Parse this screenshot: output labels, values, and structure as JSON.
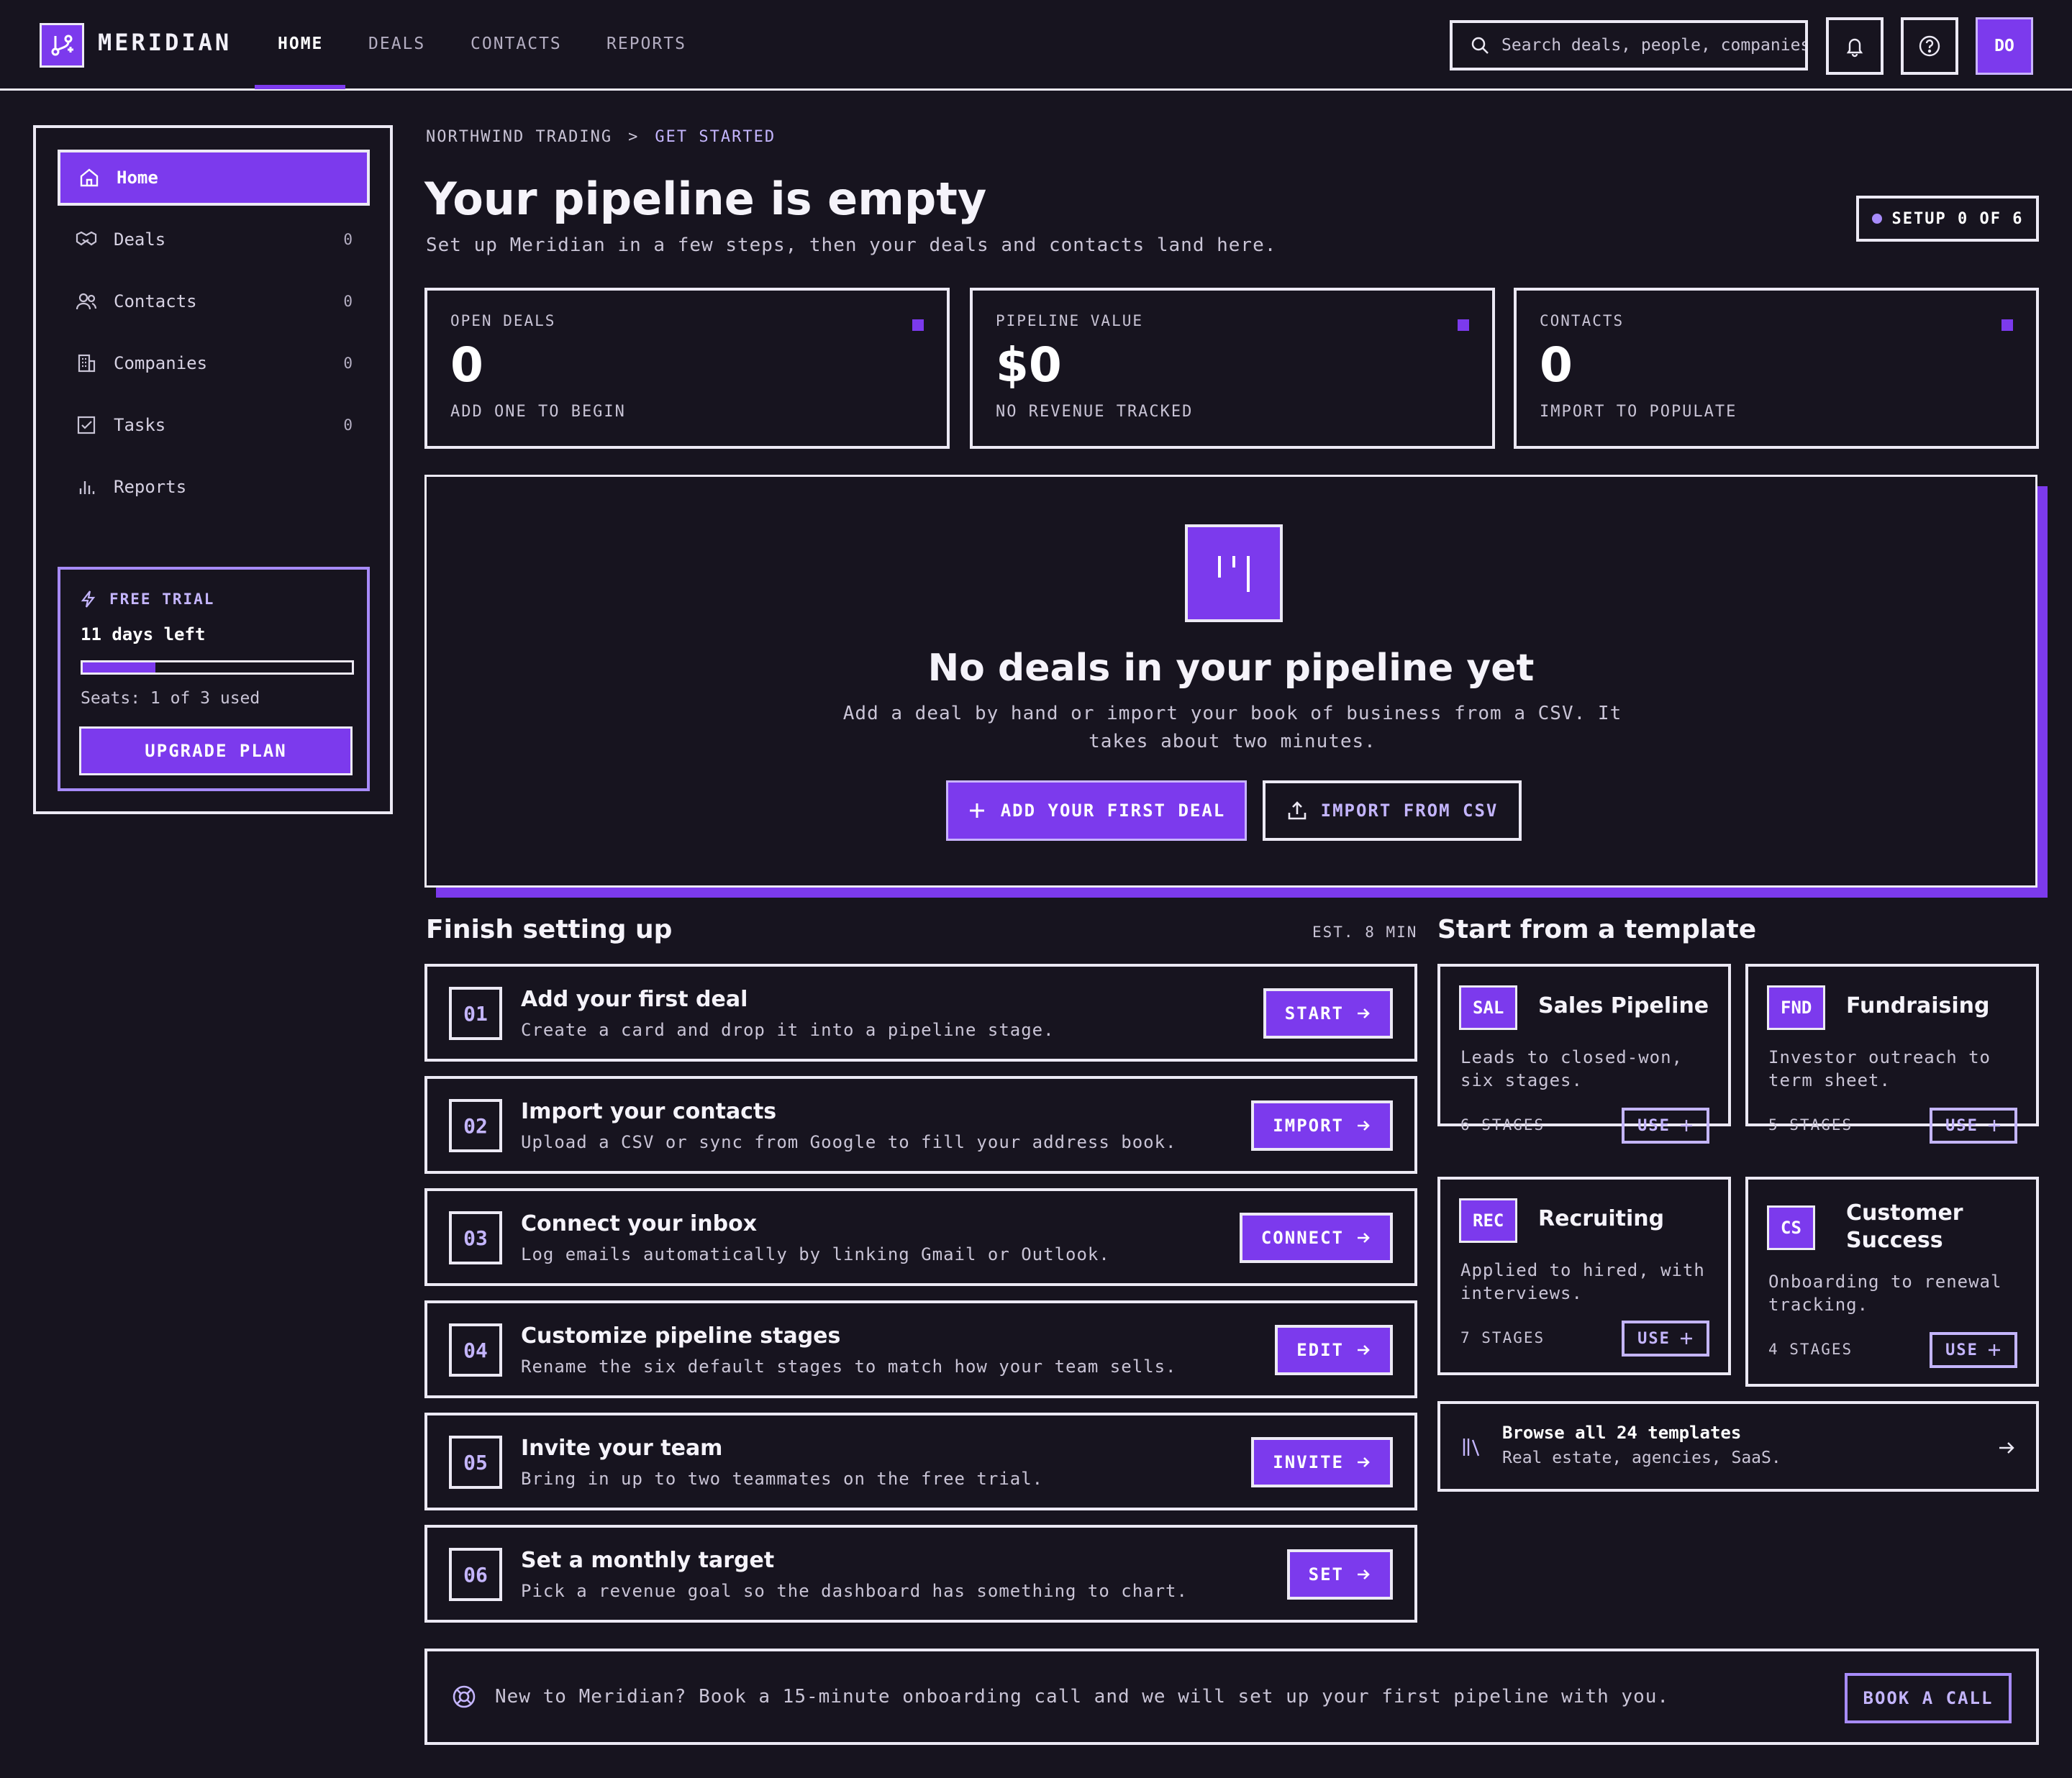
{
  "app": {
    "brand": "MERIDIAN"
  },
  "nav": {
    "tabs": [
      {
        "label": "HOME",
        "active": true
      },
      {
        "label": "DEALS"
      },
      {
        "label": "CONTACTS"
      },
      {
        "label": "REPORTS"
      }
    ]
  },
  "search": {
    "placeholder": "Search deals, people, companies"
  },
  "user": {
    "initials": "DO"
  },
  "sidebar": {
    "items": [
      {
        "label": "Home",
        "icon": "home-icon",
        "active": true
      },
      {
        "label": "Deals",
        "icon": "handshake-icon",
        "count": "0"
      },
      {
        "label": "Contacts",
        "icon": "users-icon",
        "count": "0"
      },
      {
        "label": "Companies",
        "icon": "building-icon",
        "count": "0"
      },
      {
        "label": "Tasks",
        "icon": "checkbox-icon",
        "count": "0"
      },
      {
        "label": "Reports",
        "icon": "bar-chart-icon"
      }
    ],
    "trial": {
      "label": "FREE TRIAL",
      "days": "11 days left",
      "progress_fraction": 0.27,
      "seats": "Seats: 1 of 3 used",
      "upgrade_label": "UPGRADE PLAN"
    }
  },
  "breadcrumb": {
    "parent": "NORTHWIND TRADING",
    "separator": ">",
    "current": "GET STARTED"
  },
  "page": {
    "title": "Your pipeline is empty",
    "subtitle": "Set up Meridian in a few steps, then your deals and contacts land here.",
    "setup_badge": "SETUP 0 OF 6"
  },
  "stats": [
    {
      "label": "OPEN DEALS",
      "value": "0",
      "hint": "ADD ONE TO BEGIN"
    },
    {
      "label": "PIPELINE VALUE",
      "value": "$0",
      "hint": "NO REVENUE TRACKED"
    },
    {
      "label": "CONTACTS",
      "value": "0",
      "hint": "IMPORT TO POPULATE"
    }
  ],
  "empty_state": {
    "title": "No deals in your pipeline yet",
    "description": "Add a deal by hand or import your book of business from a CSV. It takes about two minutes.",
    "primary_label": "ADD YOUR FIRST DEAL",
    "secondary_label": "IMPORT FROM CSV"
  },
  "setup": {
    "title": "Finish setting up",
    "estimate": "EST. 8 MIN",
    "steps": [
      {
        "num": "01",
        "title": "Add your first deal",
        "desc": "Create a card and drop it into a pipeline stage.",
        "action": "START"
      },
      {
        "num": "02",
        "title": "Import your contacts",
        "desc": "Upload a CSV or sync from Google to fill your address book.",
        "action": "IMPORT"
      },
      {
        "num": "03",
        "title": "Connect your inbox",
        "desc": "Log emails automatically by linking Gmail or Outlook.",
        "action": "CONNECT"
      },
      {
        "num": "04",
        "title": "Customize pipeline stages",
        "desc": "Rename the six default stages to match how your team sells.",
        "action": "EDIT"
      },
      {
        "num": "05",
        "title": "Invite your team",
        "desc": "Bring in up to two teammates on the free trial.",
        "action": "INVITE"
      },
      {
        "num": "06",
        "title": "Set a monthly target",
        "desc": "Pick a revenue goal so the dashboard has something to chart.",
        "action": "SET"
      }
    ]
  },
  "templates": {
    "title": "Start from a template",
    "items": [
      {
        "code": "SAL",
        "name": "Sales Pipeline",
        "desc": "Leads to closed-won, six stages.",
        "stages": "6 STAGES",
        "action": "USE"
      },
      {
        "code": "FND",
        "name": "Fundraising",
        "desc": "Investor outreach to term sheet.",
        "stages": "5 STAGES",
        "action": "USE"
      },
      {
        "code": "REC",
        "name": "Recruiting",
        "desc": "Applied to hired, with interviews.",
        "stages": "7 STAGES",
        "action": "USE"
      },
      {
        "code": "CS",
        "name": "Customer Success",
        "desc": "Onboarding to renewal tracking.",
        "stages": "4 STAGES",
        "action": "USE"
      }
    ],
    "browse": {
      "title": "Browse all 24 templates",
      "subtitle": "Real estate, agencies, SaaS."
    }
  },
  "onboarding": {
    "text": "New to Meridian? Book a 15-minute onboarding call and we will set up your first pipeline with you.",
    "button": "BOOK A CALL"
  },
  "colors": {
    "accent": "#7c3aed",
    "accent_light": "#c4b5fd",
    "background": "#17141f",
    "border": "#ece9f4"
  }
}
